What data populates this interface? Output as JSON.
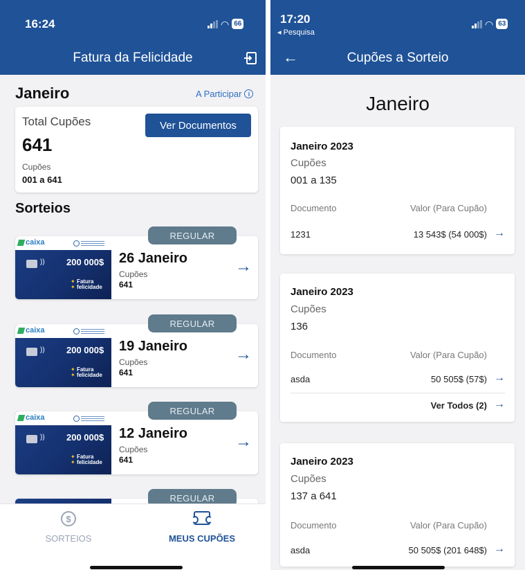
{
  "left": {
    "status": {
      "time": "16:24",
      "battery": "66"
    },
    "header": {
      "title": "Fatura da Felicidade",
      "exit_icon": "exit-icon"
    },
    "month": "Janeiro",
    "participar": "A Participar",
    "summary": {
      "total_label": "Total Cupões",
      "total_value": "641",
      "cupoes_label": "Cupões",
      "range": "001 a 641",
      "ver_docs": "Ver Documentos"
    },
    "sorteios_heading": "Sorteios",
    "draws": [
      {
        "badge": "REGULAR",
        "amount": "200 000$",
        "date": "26 Janeiro",
        "label": "Cupões",
        "count": "641"
      },
      {
        "badge": "REGULAR",
        "amount": "200 000$",
        "date": "19 Janeiro",
        "label": "Cupões",
        "count": "641"
      },
      {
        "badge": "REGULAR",
        "amount": "200 000$",
        "date": "12 Janeiro",
        "label": "Cupões",
        "count": "641"
      },
      {
        "badge": "REGULAR"
      }
    ],
    "banner": {
      "brand": "caixa",
      "logo_line1": "Fatura",
      "logo_line2": "felicidade"
    },
    "nav": {
      "sorteios": "SORTEIOS",
      "meus_cupoes": "MEUS CUPÕES",
      "active": "meus_cupoes"
    }
  },
  "right": {
    "status": {
      "time": "17:20",
      "back_label": "◂ Pesquisa",
      "battery": "63"
    },
    "header": {
      "title": "Cupões a Sorteio"
    },
    "month": "Janeiro",
    "coupons": [
      {
        "title": "Janeiro 2023",
        "label": "Cupões",
        "range": "001 a 135",
        "doc_header": "Documento",
        "value_header": "Valor (Para Cupão)",
        "doc": "1231",
        "value": "13 543$ (54 000$)"
      },
      {
        "title": "Janeiro 2023",
        "label": "Cupões",
        "range": "136",
        "doc_header": "Documento",
        "value_header": "Valor (Para Cupão)",
        "doc": "asda",
        "value": "50 505$ (57$)",
        "ver_todos": "Ver Todos (2)"
      },
      {
        "title": "Janeiro 2023",
        "label": "Cupões",
        "range": "137 a 641",
        "doc_header": "Documento",
        "value_header": "Valor (Para Cupão)",
        "doc": "asda",
        "value": "50 505$ (201 648$)"
      }
    ]
  },
  "colors": {
    "primary": "#1f5297",
    "badge": "#5f7b8c",
    "link": "#2d6ec4",
    "background": "#f2f2f4"
  }
}
